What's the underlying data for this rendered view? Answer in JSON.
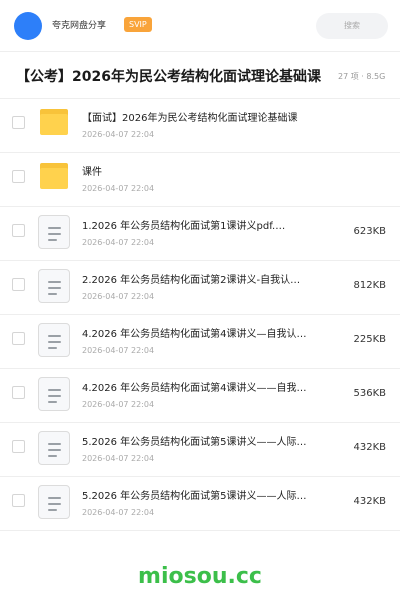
{
  "header": {
    "share_name": "夸克网盘分享",
    "badge": "SVIP",
    "search_placeholder": "搜索"
  },
  "folder": {
    "title": "【公考】2026年为民公考结构化面试理论基础课",
    "meta": "27 项 · 8.5G"
  },
  "items": [
    {
      "type": "folder",
      "name": "【面试】2026年为民公考结构化面试理论基础课",
      "date": "2026-04-07 22:04",
      "size": ""
    },
    {
      "type": "folder",
      "name": "课件",
      "date": "2026-04-07 22:04",
      "size": ""
    },
    {
      "type": "file",
      "name": "1.2026 年公务员结构化面试第1课讲义pdf.…",
      "date": "2026-04-07 22:04",
      "size": "623KB"
    },
    {
      "type": "file",
      "name": "2.2026 年公务员结构化面试第2课讲义-自我认…",
      "date": "2026-04-07 22:04",
      "size": "812KB"
    },
    {
      "type": "file",
      "name": "4.2026 年公务员结构化面试第4课讲义—自我认…",
      "date": "2026-04-07 22:04",
      "size": "225KB"
    },
    {
      "type": "file",
      "name": "4.2026 年公务员结构化面试第4课讲义——自我…",
      "date": "2026-04-07 22:04",
      "size": "536KB"
    },
    {
      "type": "file",
      "name": "5.2026 年公务员结构化面试第5课讲义——人际…",
      "date": "2026-04-07 22:04",
      "size": "432KB"
    },
    {
      "type": "file",
      "name": "5.2026 年公务员结构化面试第5课讲义——人际…",
      "date": "2026-04-07 22:04",
      "size": "432KB"
    }
  ],
  "watermark": "miosou.cc",
  "colors": {
    "avatar": "#2d7ff9",
    "badge": "#f9a43a",
    "folder": "#ffd24d",
    "watermark": "#3cbf4a"
  }
}
